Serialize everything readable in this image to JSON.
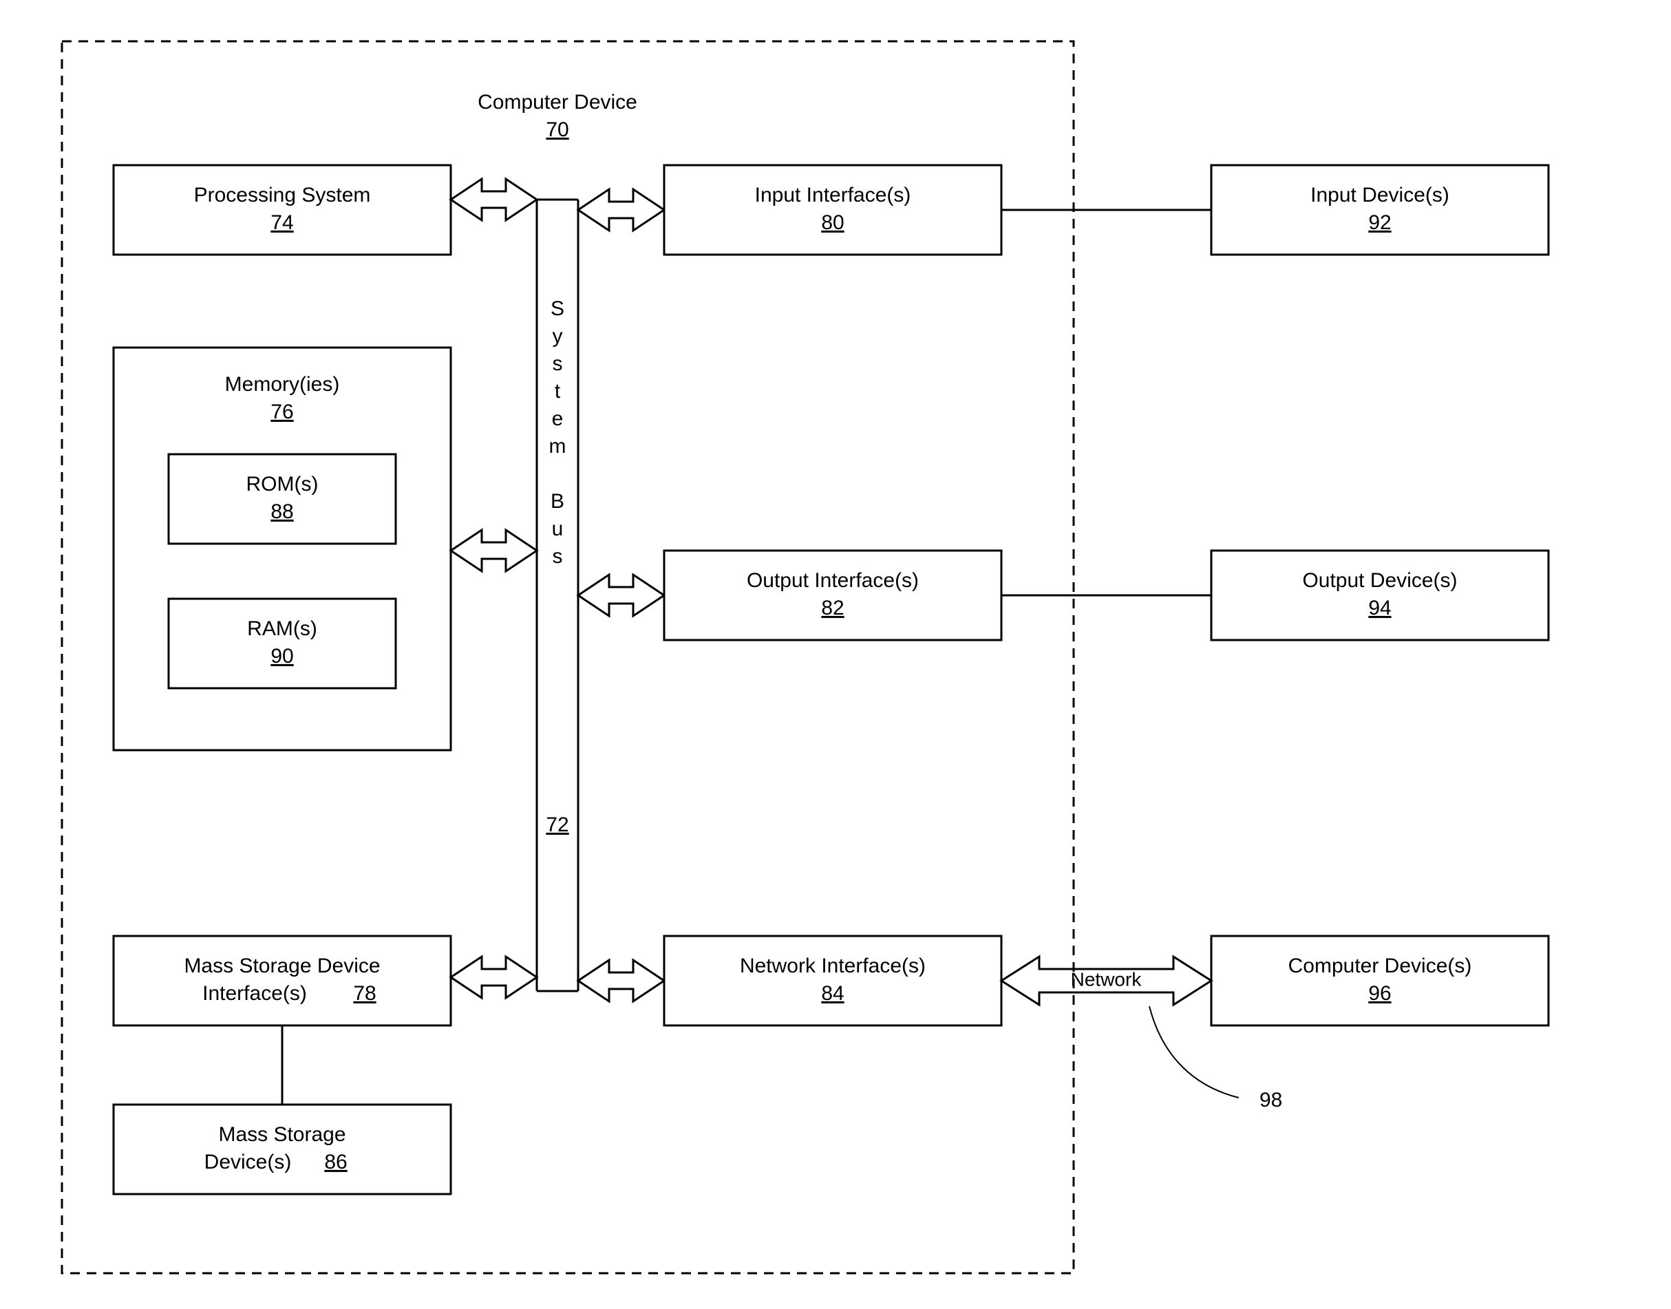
{
  "title": {
    "label": "Computer Device",
    "num": "70"
  },
  "bus": {
    "label": "System Bus",
    "num": "72"
  },
  "proc": {
    "label": "Processing System",
    "num": "74"
  },
  "mem": {
    "label": "Memory(ies)",
    "num": "76"
  },
  "mass_if": {
    "label": "Mass Storage Device Interface(s)",
    "num": "78"
  },
  "in_if": {
    "label": "Input Interface(s)",
    "num": "80"
  },
  "out_if": {
    "label": "Output Interface(s)",
    "num": "82"
  },
  "net_if": {
    "label": "Network Interface(s)",
    "num": "84"
  },
  "mass": {
    "label": "Mass Storage Device(s)",
    "num": "86"
  },
  "rom": {
    "label": "ROM(s)",
    "num": "88"
  },
  "ram": {
    "label": "RAM(s)",
    "num": "90"
  },
  "in_dev": {
    "label": "Input Device(s)",
    "num": "92"
  },
  "out_dev": {
    "label": "Output Device(s)",
    "num": "94"
  },
  "cpu_dev": {
    "label": "Computer Device(s)",
    "num": "96"
  },
  "network": {
    "label": "Network",
    "num": "98"
  }
}
